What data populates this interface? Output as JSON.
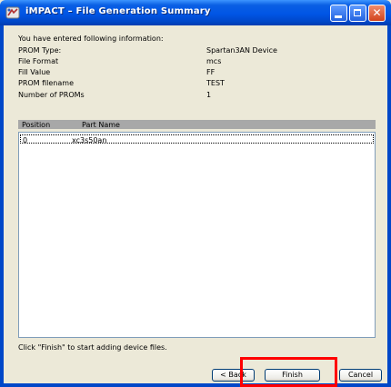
{
  "window": {
    "title": "iMPACT – File Generation Summary",
    "icon": "impact-app-icon",
    "close_glyph": "✕"
  },
  "summary": {
    "intro": "You have entered following information:",
    "fields": [
      {
        "label": "PROM Type:",
        "value": "Spartan3AN Device"
      },
      {
        "label": "File Format",
        "value": "mcs"
      },
      {
        "label": "Fill Value",
        "value": "FF"
      },
      {
        "label": "PROM filename",
        "value": "TEST"
      },
      {
        "label": "Number of PROMs",
        "value": "1"
      }
    ]
  },
  "table": {
    "headers": [
      "Position",
      "Part Name"
    ],
    "rows": [
      {
        "position": "0",
        "part_name": "xc3s50an"
      }
    ]
  },
  "hint": "Click \"Finish\" to start adding device files.",
  "buttons": {
    "back": "< Back",
    "finish": "Finish",
    "cancel": "Cancel"
  },
  "colors": {
    "title_bar": "#0055e5",
    "highlight": "#ff0000",
    "header_row": "#a8a8a8"
  }
}
